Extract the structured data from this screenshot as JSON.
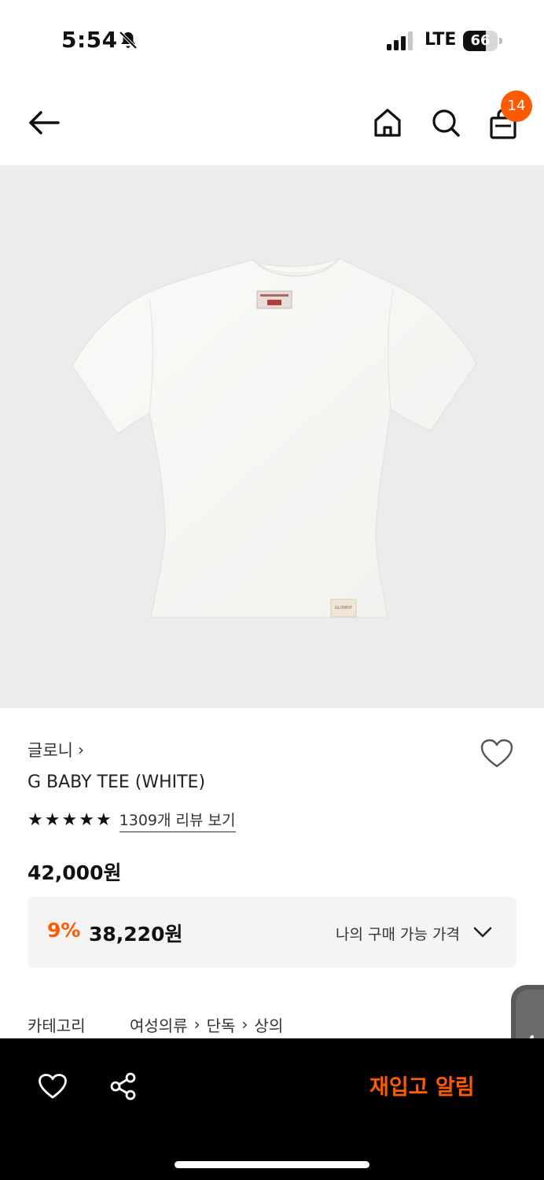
{
  "status_bar": {
    "time": "5:54",
    "network": "LTE",
    "battery_percent": "66",
    "battery_level": 0.66,
    "icons": [
      "bell-off-icon",
      "signal-icon",
      "battery-icon"
    ]
  },
  "nav": {
    "icons": [
      "back-arrow-icon",
      "home-icon",
      "search-icon",
      "shopping-bag-icon"
    ],
    "cart_count": "14"
  },
  "product": {
    "brand": "글로니",
    "brand_chevron": "›",
    "title": "G BABY TEE (WHITE)",
    "rating_stars": 5,
    "review_link": "1309개 리뷰 보기",
    "list_price": "42,000원",
    "discount_rate": "9%",
    "sale_price": "38,220원",
    "price_option_label": "나의 구매 가능 가격",
    "label_tag_text": "GLOWNY"
  },
  "category": {
    "label": "카테고리",
    "path": [
      "여성의류",
      "단독",
      "상의"
    ]
  },
  "bottom_bar": {
    "restock_label": "재입고 알림",
    "icons": [
      "heart-icon",
      "share-icon"
    ]
  },
  "colors": {
    "accent": "#ff5a00",
    "image_bg": "#ececec",
    "bottom_bar_bg": "#000000"
  }
}
